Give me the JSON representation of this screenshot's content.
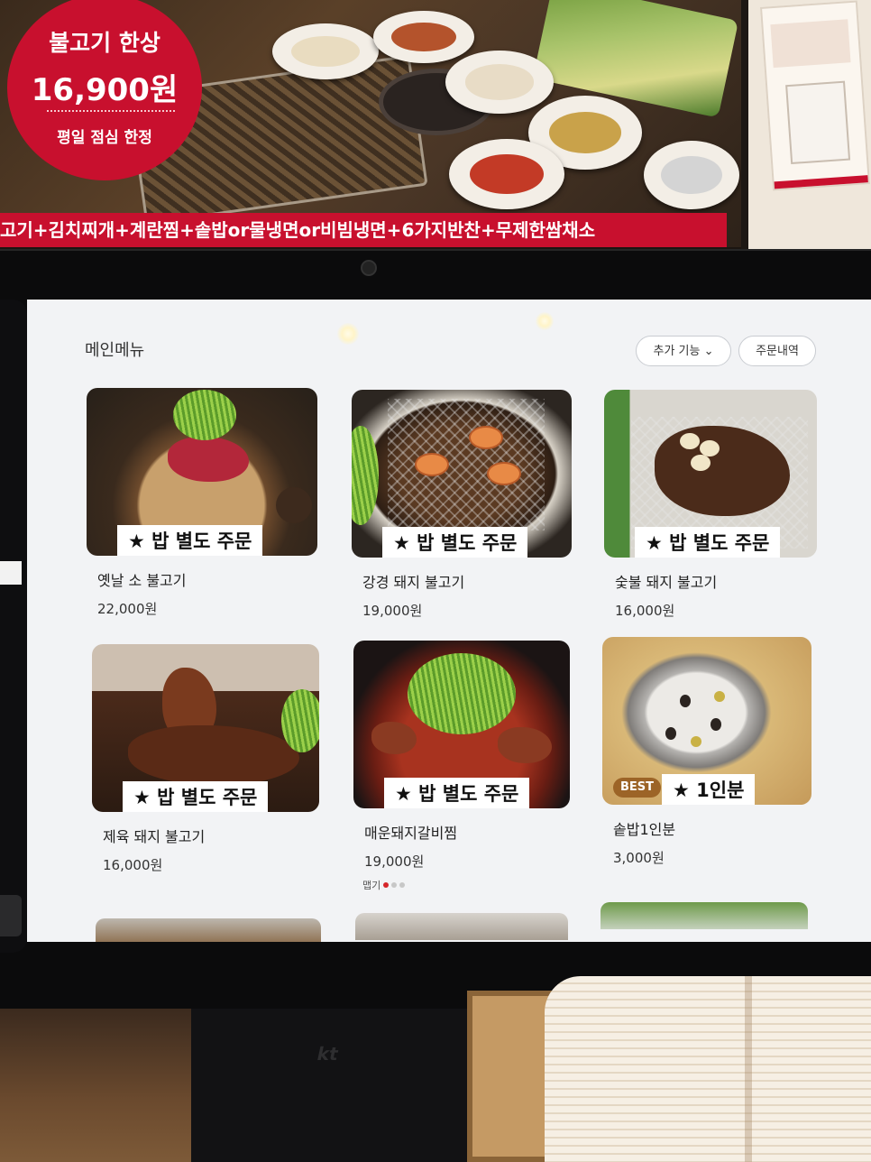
{
  "poster": {
    "badge_title": "불고기 한상",
    "badge_price": "16,900원",
    "badge_note": "평일 점심 한정",
    "strip_text": "고기+김치찌개+계란찜+솥밥or물냉면or비빔냉면+6가지반찬+무제한쌈채소"
  },
  "kiosk": {
    "section_title": "메인메뉴",
    "more_button": "추가 기능",
    "more_chevron": "⌄",
    "orders_button": "주문내역",
    "menu": [
      {
        "name": "옛날 소 불고기",
        "price": "22,000원",
        "tag": "★ 밥 별도 주문"
      },
      {
        "name": "강경 돼지 불고기",
        "price": "19,000원",
        "tag": "★ 밥 별도 주문"
      },
      {
        "name": "숯불 돼지 불고기",
        "price": "16,000원",
        "tag": "★ 밥 별도 주문"
      },
      {
        "name": "제육 돼지 불고기",
        "price": "16,000원",
        "tag": "★ 밥 별도 주문"
      },
      {
        "name": "매운돼지갈비찜",
        "price": "19,000원",
        "tag": "★ 밥 별도 주문",
        "spicy_label": "맵기",
        "spicy_level": 1,
        "spicy_max": 3
      },
      {
        "name": "솥밥1인분",
        "price": "3,000원",
        "tag": "★ 1인분",
        "badge": "BEST"
      }
    ]
  },
  "stand_logo": "kt",
  "colors": {
    "brand_red": "#c8102e",
    "best_badge": "#9c6427",
    "spicy_on": "#d6262b",
    "screen_bg": "#f2f3f5"
  },
  "icons": {
    "star": "★",
    "chevron": "chevron-down-icon"
  }
}
